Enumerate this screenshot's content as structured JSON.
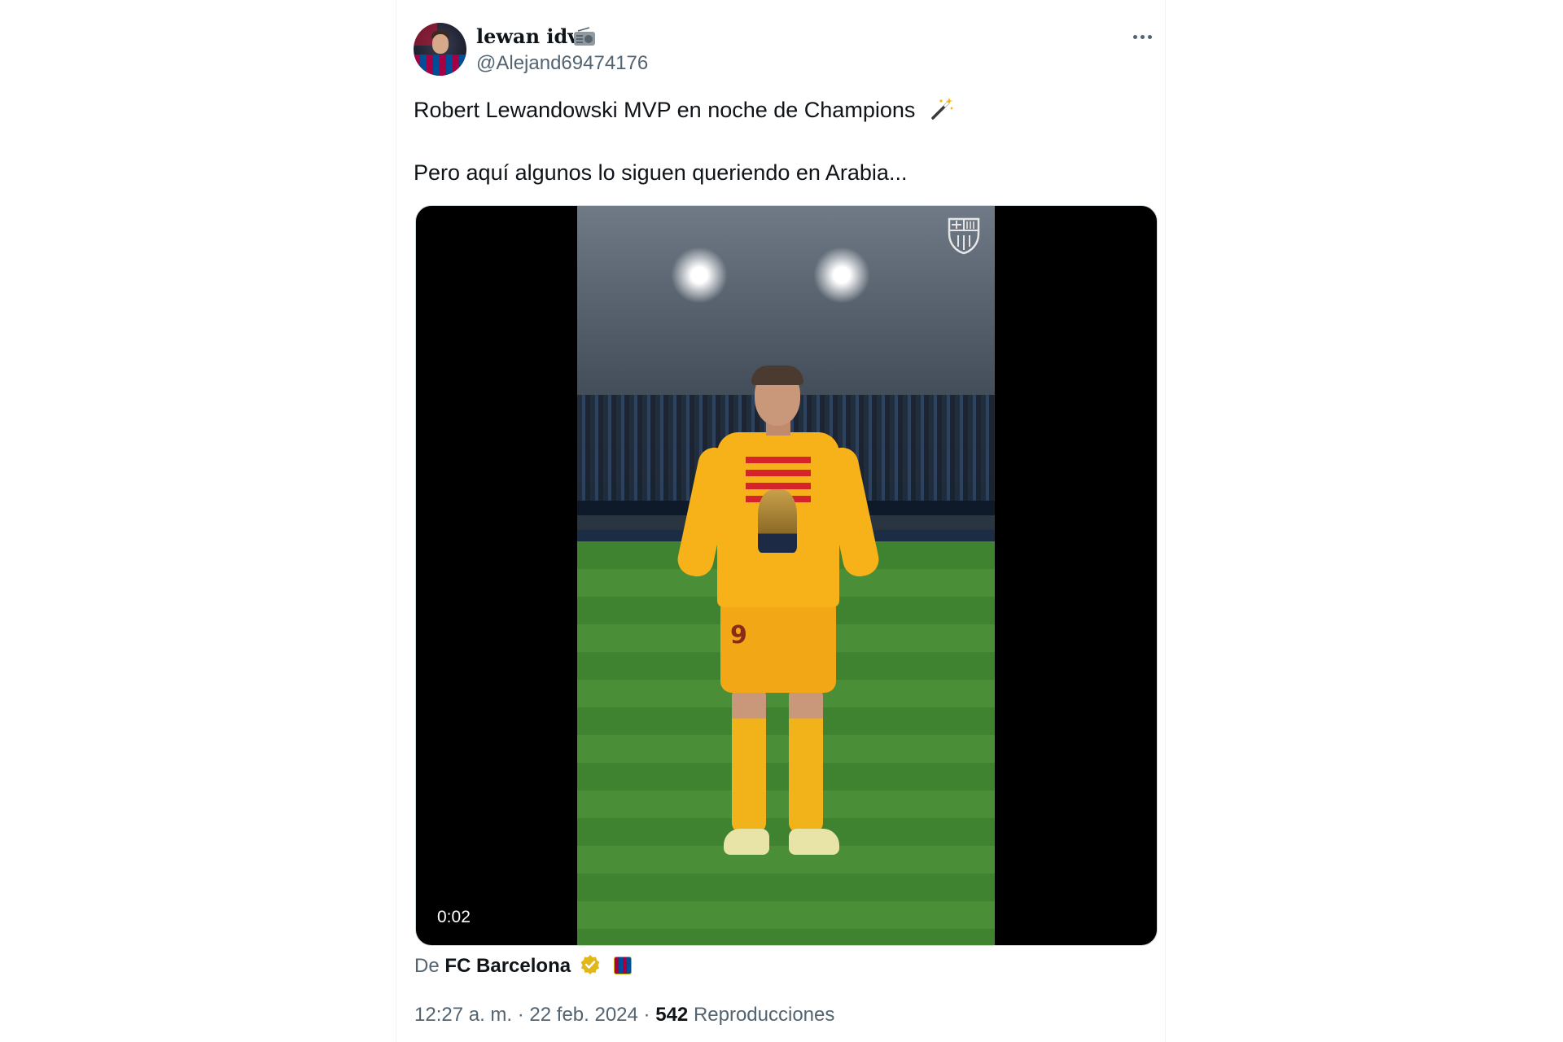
{
  "author": {
    "display_name": "lewan idv",
    "handle": "@Alejand69474176",
    "avatar_icon": "avatar-icon",
    "name_emoji_icon": "radio-icon"
  },
  "tweet": {
    "line1": "Robert Lewandowski MVP en noche de Champions",
    "line2": "Pero aquí algunos lo siguen queriendo en Arabia...",
    "emoji_icon": "magic-wand-icon"
  },
  "media": {
    "duration": "0:02",
    "watermark_icon": "fc-barcelona-crest-icon",
    "jersey_number": "9"
  },
  "attribution": {
    "prefix": "De",
    "source": "FC Barcelona",
    "verified_icon": "verified-gold-badge-icon",
    "flag_icon": "barcelona-flag-icon"
  },
  "meta": {
    "time": "12:27 a. m.",
    "separator": "·",
    "date": "22 feb. 2024",
    "views_count": "542",
    "views_label": "Reproducciones"
  },
  "colors": {
    "text_primary": "#0f1419",
    "text_secondary": "#536471",
    "border": "#cfd9de",
    "verified_gold": "#e2b719",
    "jersey_yellow": "#f7b21a"
  }
}
